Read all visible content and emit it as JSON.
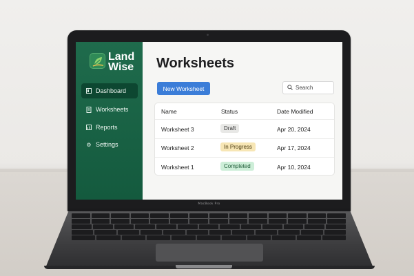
{
  "device": {
    "model_label": "MacBook Pro"
  },
  "app": {
    "logo_line1": "Land",
    "logo_line2": "Wise",
    "brand_color": "#1f6b4c",
    "accent_color": "#3b7dd8"
  },
  "sidebar": {
    "items": [
      {
        "label": "Dashboard",
        "icon": "dashboard-icon",
        "active": true
      },
      {
        "label": "Worksheets",
        "icon": "worksheet-icon",
        "active": false
      },
      {
        "label": "Reports",
        "icon": "reports-icon",
        "active": false
      },
      {
        "label": "Settings",
        "icon": "gear-icon",
        "active": false
      }
    ]
  },
  "main": {
    "title": "Worksheets",
    "new_button": "New Worksheet",
    "search": {
      "label": "Search",
      "icon": "search-icon"
    },
    "table": {
      "columns": [
        "Name",
        "Status",
        "Date Modified"
      ],
      "rows": [
        {
          "name": "Worksheet 3",
          "status": "Draft",
          "date": "Apr 20, 2024",
          "status_bg": "#e8e8e6",
          "status_fg": "#333333"
        },
        {
          "name": "Worksheet 2",
          "status": "In Progress",
          "date": "Apr 17, 2024",
          "status_bg": "#f7e6b5",
          "status_fg": "#4a3a10"
        },
        {
          "name": "Worksheet 1",
          "status": "Completed",
          "date": "Apr 10, 2024",
          "status_bg": "#cdeed8",
          "status_fg": "#1e5a36"
        }
      ]
    }
  }
}
